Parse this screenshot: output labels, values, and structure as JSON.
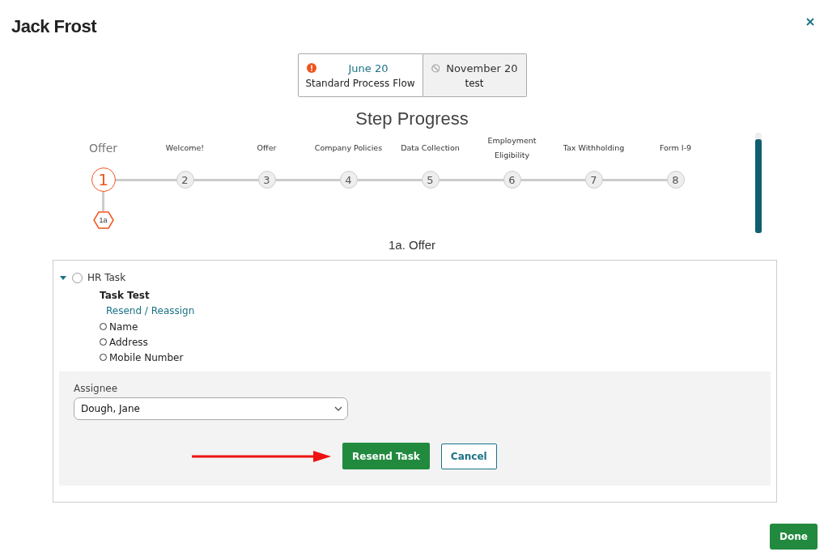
{
  "dialog": {
    "title": "Jack Frost"
  },
  "flows": [
    {
      "kind": "warning",
      "date": "June 20",
      "name": "Standard Process Flow",
      "selected": true
    },
    {
      "kind": "blocked",
      "date": "November 20",
      "name": "test",
      "selected": false
    }
  ],
  "step_progress": {
    "title": "Step Progress",
    "steps": [
      {
        "label": "Offer",
        "number": "1",
        "selected": true,
        "children": [
          {
            "label": "1a",
            "selected": true
          }
        ]
      },
      {
        "label": "Welcome!",
        "number": "2",
        "selected": false
      },
      {
        "label": "Offer",
        "number": "3",
        "selected": false
      },
      {
        "label": "Company Policies",
        "number": "4",
        "selected": false
      },
      {
        "label": "Data Collection",
        "number": "5",
        "selected": false
      },
      {
        "label": "Employment Eligibility",
        "number": "6",
        "selected": false
      },
      {
        "label": "Tax Withholding",
        "number": "7",
        "selected": false
      },
      {
        "label": "Form I-9",
        "number": "8",
        "selected": false
      }
    ]
  },
  "substep_title": "1a. Offer",
  "task": {
    "label": "HR Task",
    "expanded": true,
    "checked": false,
    "name": "Task Test",
    "link": "Resend / Reassign",
    "fields": [
      {
        "label": "Name",
        "checked": false
      },
      {
        "label": "Address",
        "checked": false
      },
      {
        "label": "Mobile Number",
        "checked": false
      }
    ],
    "assignee_label": "Assignee",
    "assignee": "Dough, Jane",
    "primary_button": "Resend Task",
    "secondary_button": "Cancel"
  },
  "done_button": "Done"
}
